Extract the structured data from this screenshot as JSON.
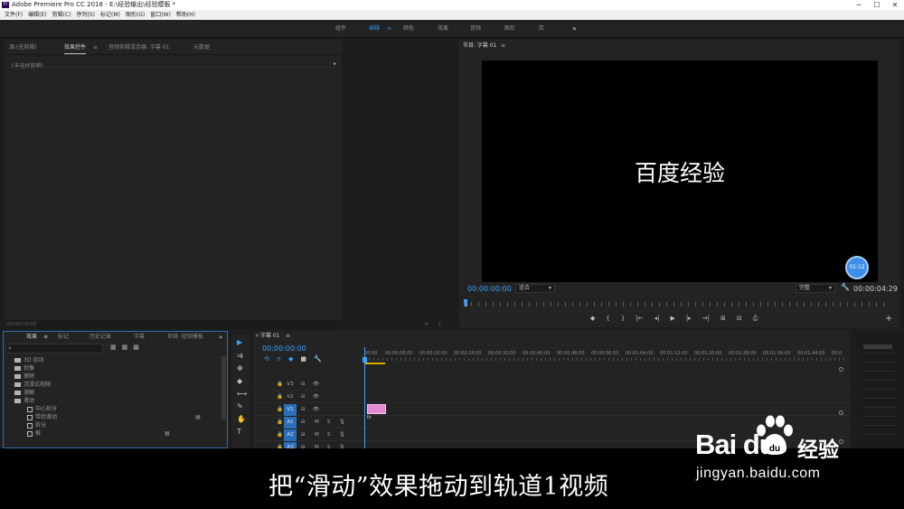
{
  "titlebar": {
    "title": "Adobe Premiere Pro CC 2018 - E:\\经验输出\\经验模板 *",
    "icon": "Pr",
    "controls": [
      "─",
      "☐",
      "✕"
    ]
  },
  "menubar": [
    "文件(F)",
    "编辑(E)",
    "剪辑(C)",
    "序列(S)",
    "标记(M)",
    "图形(G)",
    "窗口(W)",
    "帮助(H)"
  ],
  "workspaces": {
    "items": [
      "组件",
      "编辑",
      "颜色",
      "效果",
      "音频",
      "图形",
      "库"
    ],
    "active": "编辑",
    "menu_icon": "≡",
    "more": "»"
  },
  "effect_controls": {
    "tabs": [
      "源:(无剪辑)",
      "效果控件",
      "音频剪辑混合器: 字幕 01",
      "元数据"
    ],
    "active_tab": "效果控件",
    "menu_icon": "≡",
    "no_clip": "(未选择剪辑)",
    "arrow": "▸",
    "timecode": "00;00;00;00",
    "footer_icons": [
      "⊳",
      "⇪"
    ]
  },
  "program_monitor": {
    "title": "节目: 字幕 01",
    "menu_icon": "≡",
    "overlay_text": "百度经验",
    "badge": "01:12",
    "current_time": "00:00:00:00",
    "fit": "适合",
    "quality": "完整",
    "duration": "00:00:04:29",
    "transport": [
      "◆",
      "{",
      "}",
      "|←",
      "◂|",
      "▶",
      "|▸",
      "→|",
      "⊞",
      "⊟",
      "⎙"
    ],
    "add": "+",
    "wrench": "🔧",
    "dropdown": "▾"
  },
  "effects_panel": {
    "tabs": [
      "效果",
      "标记",
      "历史记录",
      "字幕",
      "项目: 经验模板"
    ],
    "active_tab": "效果",
    "menu_icon": "≡",
    "more": "»",
    "search_icon": "⌕",
    "buttons": [
      "▦",
      "▦",
      "▦"
    ],
    "tree": [
      {
        "label": "3D 运动",
        "type": "folder",
        "depth": 1
      },
      {
        "label": "划像",
        "type": "folder",
        "depth": 1
      },
      {
        "label": "擦除",
        "type": "folder",
        "depth": 1
      },
      {
        "label": "沉浸式视频",
        "type": "folder",
        "depth": 1
      },
      {
        "label": "溶解",
        "type": "folder",
        "depth": 1
      },
      {
        "label": "滑动",
        "type": "folder",
        "depth": 1,
        "expanded": true
      },
      {
        "label": "中心拆分",
        "type": "effect",
        "depth": 2
      },
      {
        "label": "带状滑动",
        "type": "effect",
        "depth": 2,
        "badge": "▦"
      },
      {
        "label": "拆分",
        "type": "effect",
        "depth": 2
      },
      {
        "label": "推",
        "type": "effect",
        "depth": 2,
        "badge": "▦"
      }
    ]
  },
  "tools": [
    "▶",
    "⇉",
    "✥",
    "◆",
    "⟷",
    "✎",
    "✋",
    "T"
  ],
  "timeline": {
    "tab": "字幕 01",
    "close": "×",
    "menu_icon": "≡",
    "current_time": "00:00:00:00",
    "toolbar_icons": [
      "⟲",
      "∩",
      "◆",
      "■",
      "🔧"
    ],
    "ruler_labels": [
      "00:00",
      "00:00:08:00",
      "00:00:16:00",
      "00:00:24:00",
      "00:00:32:00",
      "00:00:40:00",
      "00:00:48:00",
      "00:00:56:00",
      "00:01:04:00",
      "00:01:12:00",
      "00:01:20:00",
      "00:01:28:00",
      "00:01:36:00",
      "00:01:44:00",
      "00:0"
    ],
    "tracks": [
      {
        "name": "V3",
        "type": "video",
        "highlight": false
      },
      {
        "name": "V2",
        "type": "video",
        "highlight": false
      },
      {
        "name": "V1",
        "type": "video",
        "highlight": true
      },
      {
        "name": "A1",
        "type": "audio",
        "highlight": true
      },
      {
        "name": "A2",
        "type": "audio",
        "highlight": true
      },
      {
        "name": "A3",
        "type": "audio",
        "highlight": true
      }
    ],
    "lock_icon": "🔒",
    "sync_icon": "⊟",
    "eye_icon": "👁",
    "mute": "M",
    "solo": "S",
    "mic_icon": "🎙",
    "clip_fx": "fx"
  },
  "subtitle": "把“滑动”效果拖动到轨道1视频",
  "watermark": {
    "brand": "Bai du",
    "brand_cn": "经验",
    "url": "jingyan.baidu.com"
  },
  "colors": {
    "accent": "#2d8ceb",
    "timecode": "#3aa0ff",
    "clip": "#e38ad0",
    "track_highlight": "#2b6fba"
  }
}
